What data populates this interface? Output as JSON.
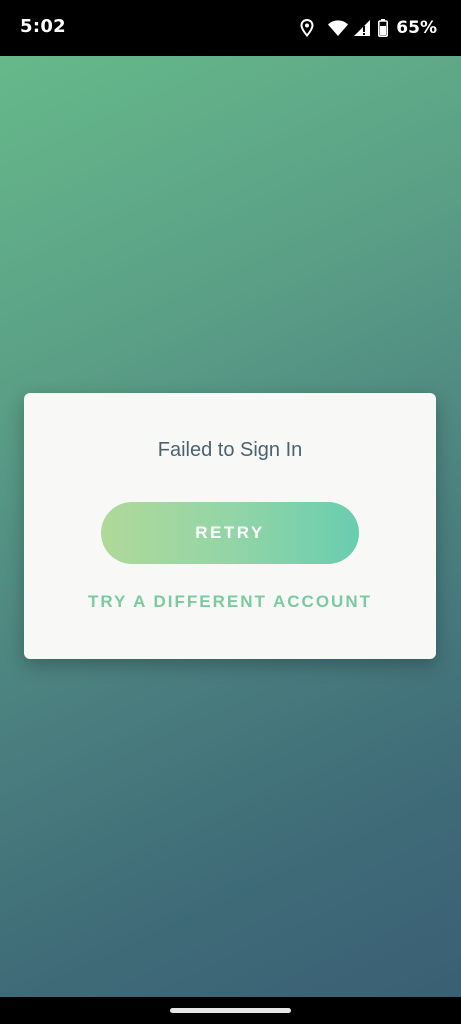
{
  "status_bar": {
    "time": "5:02",
    "battery": "65%",
    "icons": [
      "location-icon",
      "wifi-icon",
      "cell-signal-icon",
      "battery-icon"
    ]
  },
  "dialog": {
    "title": "Failed to Sign In",
    "retry_label": "RETRY",
    "alt_account_label": "TRY A DIFFERENT ACCOUNT"
  },
  "colors": {
    "background_top": "#66b98a",
    "background_bottom": "#3a5f74",
    "dialog_bg": "#f8f8f6",
    "title_text": "#4b6370",
    "retry_gradient_start": "#b0d99a",
    "retry_gradient_end": "#69cdb0",
    "alt_account_text": "#7ccaa0"
  }
}
